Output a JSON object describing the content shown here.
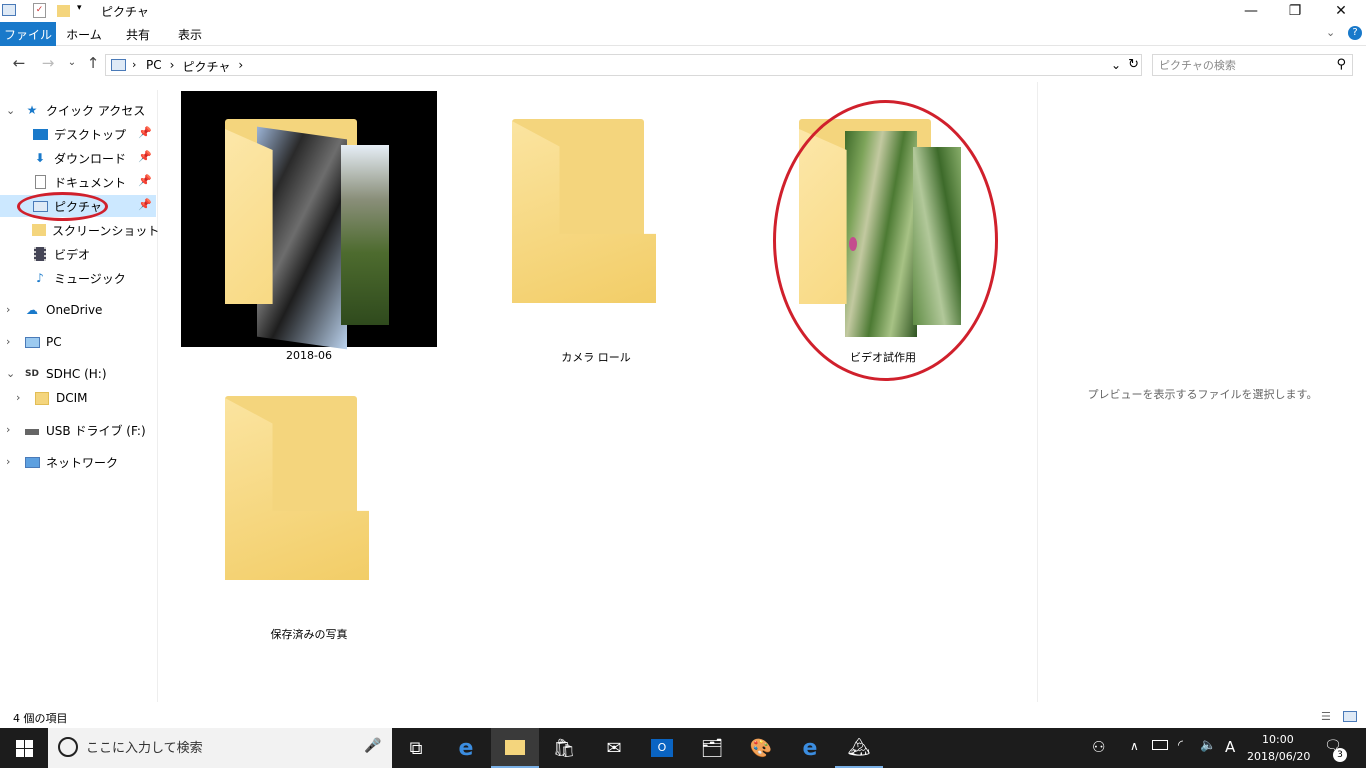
{
  "window": {
    "title": "ピクチャ",
    "minimize_icon": "minimize-icon",
    "maximize_icon": "restore-icon",
    "close_icon": "close-icon"
  },
  "ribbon": {
    "tabs": [
      "ファイル",
      "ホーム",
      "共有",
      "表示"
    ],
    "accent": "#1979ca"
  },
  "address": {
    "crumbs": [
      "PC",
      "ピクチャ"
    ],
    "search_placeholder": "ピクチャの検索"
  },
  "nav": {
    "quick_access": "クイック アクセス",
    "items": [
      {
        "label": "デスクトップ",
        "icon": "desktop-icon",
        "pinned": true
      },
      {
        "label": "ダウンロード",
        "icon": "download-icon",
        "pinned": true
      },
      {
        "label": "ドキュメント",
        "icon": "document-icon",
        "pinned": true
      },
      {
        "label": "ピクチャ",
        "icon": "pictures-icon",
        "pinned": true,
        "selected": true
      },
      {
        "label": "スクリーンショット",
        "icon": "folder-icon",
        "pinned": false
      },
      {
        "label": "ビデオ",
        "icon": "video-icon",
        "pinned": false
      },
      {
        "label": "ミュージック",
        "icon": "music-icon",
        "pinned": false
      }
    ],
    "onedrive": "OneDrive",
    "pc": "PC",
    "sdhc": "SDHC (H:)",
    "dcim": "DCIM",
    "usb": "USB ドライブ (F:)",
    "network": "ネットワーク"
  },
  "folders": [
    {
      "name": "2018-06"
    },
    {
      "name": "カメラ ロール"
    },
    {
      "name": "ビデオ試作用"
    },
    {
      "name": "保存済みの写真"
    }
  ],
  "preview": {
    "message": "プレビューを表示するファイルを選択します。"
  },
  "status": {
    "count": "4 個の項目"
  },
  "taskbar": {
    "search_placeholder": "ここに入力して検索",
    "time": "10:00",
    "date": "2018/06/20",
    "notifications": "3",
    "ime": "A"
  },
  "highlight_color": "#d0202c"
}
